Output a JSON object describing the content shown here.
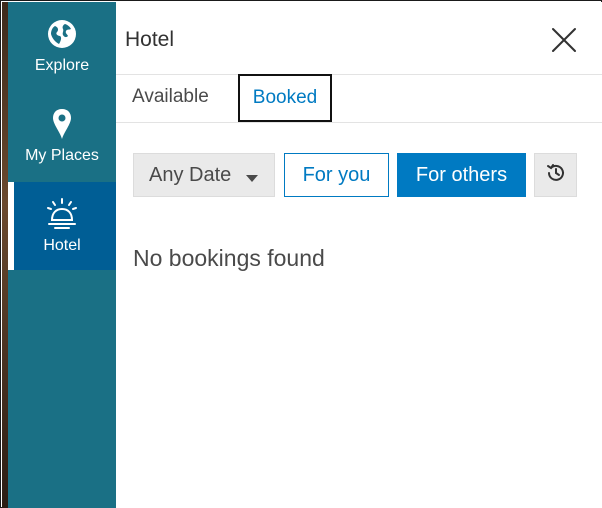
{
  "sidebar": {
    "items": [
      {
        "label": "Explore",
        "icon": "globe-icon"
      },
      {
        "label": "My Places",
        "icon": "map-pin-icon"
      },
      {
        "label": "Hotel",
        "icon": "service-bell-icon",
        "active": true
      }
    ]
  },
  "panel": {
    "title": "Hotel",
    "close_icon": "close-icon"
  },
  "tabs": [
    {
      "label": "Available",
      "selected": false
    },
    {
      "label": "Booked",
      "selected": true
    }
  ],
  "filters": {
    "date_label": "Any Date",
    "for_you_label": "For you",
    "for_others_label": "For others",
    "refresh_icon": "refresh-icon"
  },
  "empty_message": "No bookings found",
  "colors": {
    "sidebar_bg": "#1a7085",
    "active_nav_bg": "#005e95",
    "accent_blue": "#007ac2",
    "text_gray": "#4a4a4a"
  }
}
